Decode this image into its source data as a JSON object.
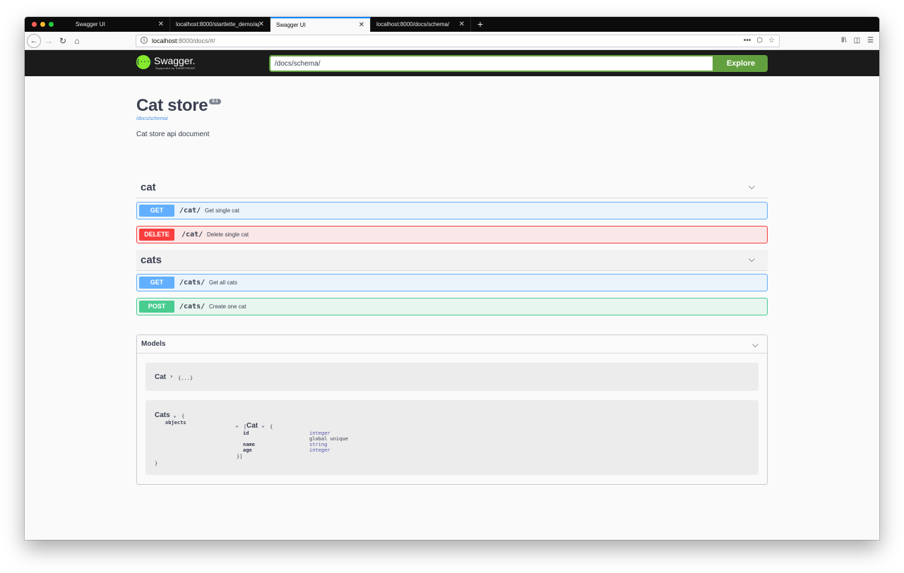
{
  "browser": {
    "tabs": [
      {
        "title": "Swagger UI"
      },
      {
        "title": "localhost:8000/startlette_demo/api"
      },
      {
        "title": "Swagger UI"
      },
      {
        "title": "localhost:8000/docs/schema/"
      }
    ],
    "url_host": "localhost",
    "url_path": ":8000/docs/#/",
    "close_glyph": "✕",
    "new_tab_glyph": "+"
  },
  "swagger": {
    "logo_text": "Swagger.",
    "logo_sub": "Supported by SMARTBEAR",
    "logo_glyph": "{···}",
    "search_value": "/docs/schema/",
    "explore_label": "Explore",
    "accent": "#62a03f"
  },
  "info": {
    "title": "Cat store",
    "version": "0.1",
    "spec_link": "/docs/schema/",
    "description": "Cat store api document"
  },
  "tags": [
    {
      "name": "cat",
      "operations": [
        {
          "method": "GET",
          "path": "/cat/",
          "summary": "Get single cat"
        },
        {
          "method": "DELETE",
          "path": "/cat/",
          "summary": "Delete single cat"
        }
      ]
    },
    {
      "name": "cats",
      "operations": [
        {
          "method": "GET",
          "path": "/cats/",
          "summary": "Get all cats"
        },
        {
          "method": "POST",
          "path": "/cats/",
          "summary": "Create one cat"
        }
      ]
    }
  ],
  "models": {
    "title": "Models",
    "cat": {
      "name": "Cat",
      "collapsed": "{...}"
    },
    "cats": {
      "name": "Cats",
      "open_brace": "{",
      "close_brace": "}",
      "prop": "objects",
      "array_open": "[",
      "inner_name": "Cat",
      "inner_open": "{",
      "inner_close": "}]",
      "fields": [
        {
          "name": "id",
          "type": "integer",
          "note": "global unique"
        },
        {
          "name": "name",
          "type": "string",
          "note": ""
        },
        {
          "name": "age",
          "type": "integer",
          "note": ""
        }
      ]
    }
  },
  "colors": {
    "get": "#61affe",
    "delete": "#f93e3e",
    "post": "#49cc90"
  }
}
